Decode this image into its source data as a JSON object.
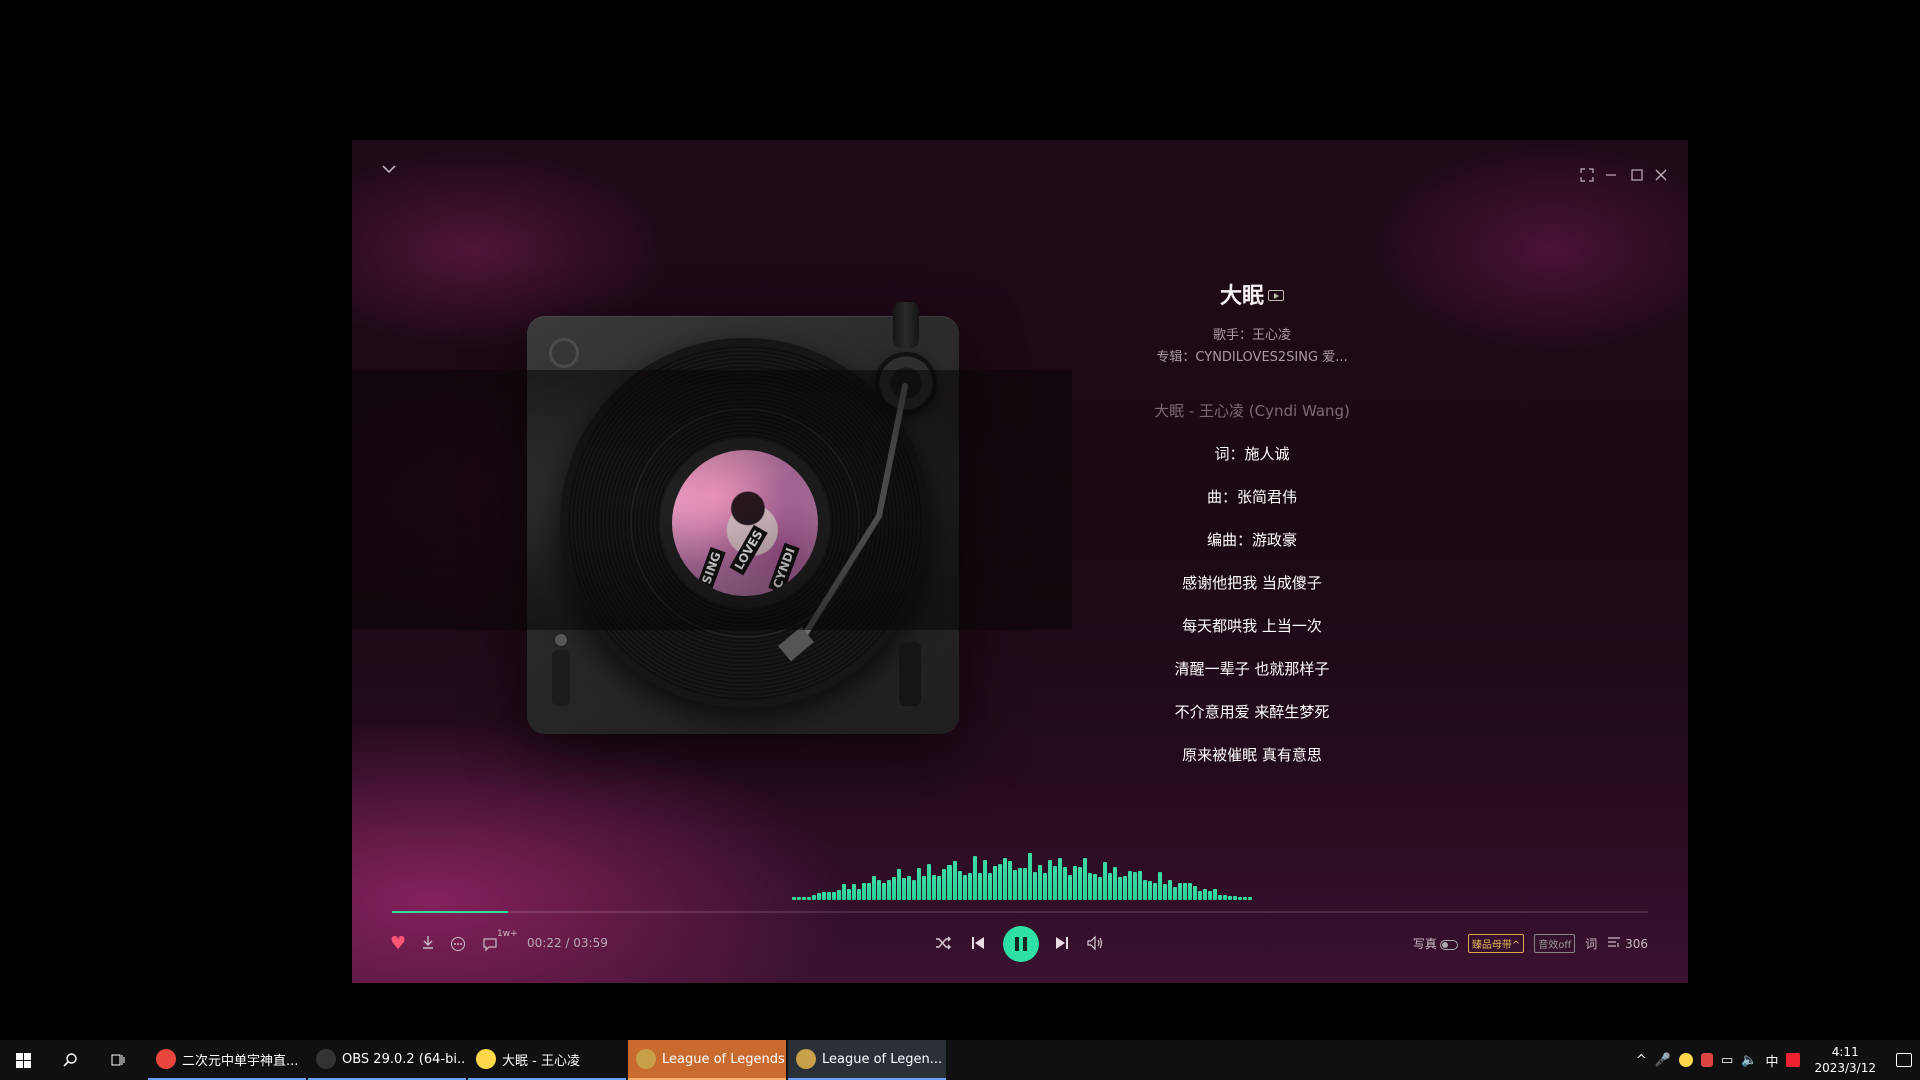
{
  "player": {
    "song_title": "大眠",
    "artist_line": "歌手：王心凌",
    "album_line": "专辑：CYNDILOVES2SING 爱...",
    "album_art_text": [
      "LOVES",
      "SING",
      "CYNDI"
    ],
    "lyrics": [
      {
        "text": "大眠 - 王心凌 (Cyndi Wang)",
        "dim": true
      },
      {
        "text": "词：施人诚",
        "dim": false
      },
      {
        "text": "曲：张简君伟",
        "dim": false
      },
      {
        "text": "编曲：游政豪",
        "dim": false
      },
      {
        "text": "感谢他把我 当成傻子",
        "dim": false
      },
      {
        "text": "每天都哄我 上当一次",
        "dim": false
      },
      {
        "text": "清醒一辈子 也就那样子",
        "dim": false
      },
      {
        "text": "不介意用爱 来醉生梦死",
        "dim": false
      },
      {
        "text": "原来被催眠 真有意思",
        "dim": false
      }
    ],
    "time_display": "00:22 / 03:59",
    "progress_fraction": 0.092,
    "comment_count": "1w+",
    "right": {
      "photo_label": "写真",
      "quality_label": "臻品母带^",
      "effect_label": "音效off",
      "lyric_label": "词",
      "playlist_count": "306"
    },
    "accent_color": "#2fe0a4"
  },
  "taskbar": {
    "tasks": [
      {
        "label": "二次元中单宇神直...",
        "icon": "chrome-icon",
        "color": "#e8453c",
        "state": "normal"
      },
      {
        "label": "OBS 29.0.2 (64-bi...",
        "icon": "obs-icon",
        "color": "#333333",
        "state": "normal"
      },
      {
        "label": "大眠 - 王心凌",
        "icon": "music-app-icon",
        "color": "#ffd84a",
        "state": "normal"
      },
      {
        "label": "League of Legends",
        "icon": "lol-icon",
        "color": "#c8a04a",
        "state": "active"
      },
      {
        "label": "League of Legen...",
        "icon": "lol-icon",
        "color": "#c8a04a",
        "state": "inactive2"
      }
    ],
    "ime_label": "中",
    "time": "4:11",
    "date": "2023/3/12"
  }
}
